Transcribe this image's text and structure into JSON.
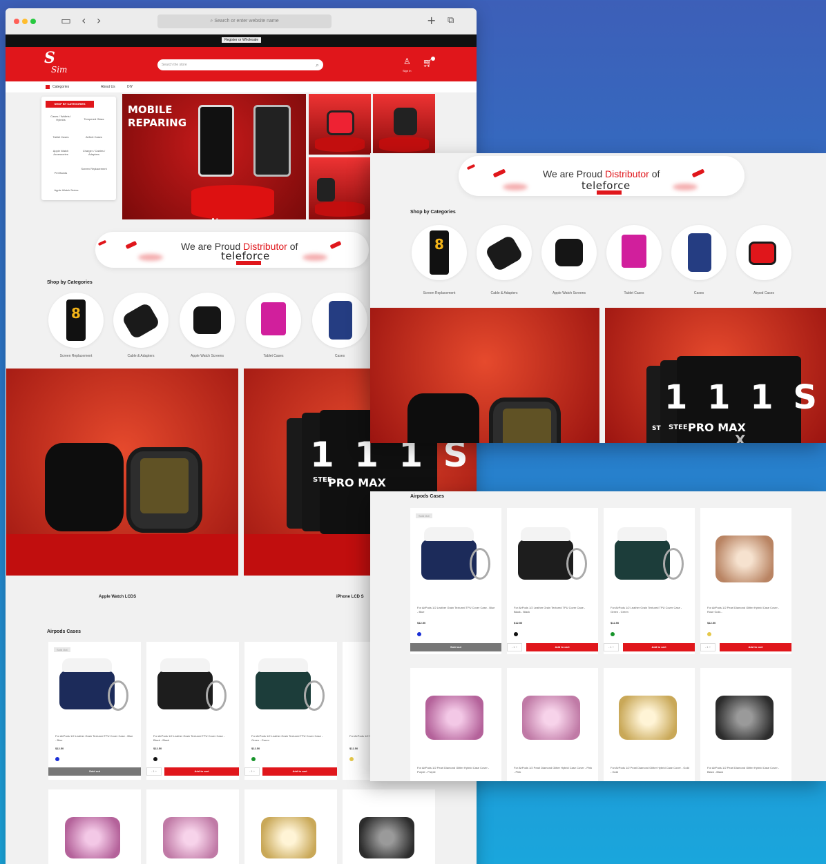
{
  "browser": {
    "url_placeholder": "Search or enter website name"
  },
  "promo_strip": {
    "label": "Register or Wholesale"
  },
  "header": {
    "logo_line1": "S",
    "logo_line2": "Sim",
    "search_placeholder": "Search the store",
    "signin_label": "Sign In"
  },
  "nav": {
    "categories": "Categories",
    "about": "About Us",
    "diy": "DIY"
  },
  "category_menu": {
    "header": "SHOP BY CATEGORIES",
    "items": [
      "Cases / Wallets / Hybrids",
      "Tempered Glass",
      "Tablet Cases",
      "Airfeet Cases",
      "Apple Watch Accessories",
      "Charger / Cables / Adapters",
      "Pet Bands",
      "Screen Replacement",
      "Apple Watch Series"
    ]
  },
  "hero": {
    "title_line1": "MOBILE",
    "title_line2": "REPARING"
  },
  "banner": {
    "text_pre": "We are Proud ",
    "text_highlight": "Distributor",
    "text_post": " of",
    "brand": "teleforce"
  },
  "shop_by_categories": {
    "title": "Shop by Categories",
    "items": [
      "Screen Replacement",
      "Cable & Adapters",
      "Apple Watch Screens",
      "Tablet Cases",
      "Cases",
      "Airpod Cases"
    ]
  },
  "promo_labels": {
    "left": "Apple Watch LCDS",
    "right": "iPhone LCD S"
  },
  "screens_text": {
    "numerals": "1 1 1 S S",
    "promax": "PRO MAX",
    "x": "X",
    "stee": "STEE",
    "st": "ST"
  },
  "airpods": {
    "title": "Airpods Cases",
    "sold_out_badge": "Sold Out",
    "sold_out_button": "Sold out",
    "add_to_cart": "Add to cart",
    "qty": "- 1 +",
    "products": [
      {
        "title": "For AirPods 1/2 Leather Grain Textured TPU Cover Case - Blue - Blue",
        "price": "$12.50",
        "swatch": "#1a2fd6"
      },
      {
        "title": "For AirPods 1/2 Leather Grain Textured TPU Cover Case - Black - Black",
        "price": "$12.50",
        "swatch": "#111111"
      },
      {
        "title": "For AirPods 1/2 Leather Grain Textured TPU Cover Case - Green - Green",
        "price": "$12.50",
        "swatch": "#17942a"
      },
      {
        "title": "For AirPods 1/2 Pearl Diamond Glitter Hybrid Case Cover - Rose Gold...",
        "price": "$12.50",
        "swatch": "#e5c84a"
      }
    ],
    "products_row2": [
      {
        "title": "For AirPods 1/2 Pearl Diamond Glitter Hybrid Case Cover - Purple - Purple"
      },
      {
        "title": "For AirPods 1/2 Pearl Diamond Glitter Hybrid Case Cover - Pink - Pink"
      },
      {
        "title": "For AirPods 1/2 Pearl Diamond Glitter Hybrid Case Cover - Gold - Gold"
      },
      {
        "title": "For AirPods 1/2 Pearl Diamond Glitter Hybrid Case Cover - Black - Black"
      }
    ]
  },
  "colors": {
    "brand_red": "#e0161b",
    "dark": "#111111",
    "bg_blue": "#3d5fb8"
  }
}
